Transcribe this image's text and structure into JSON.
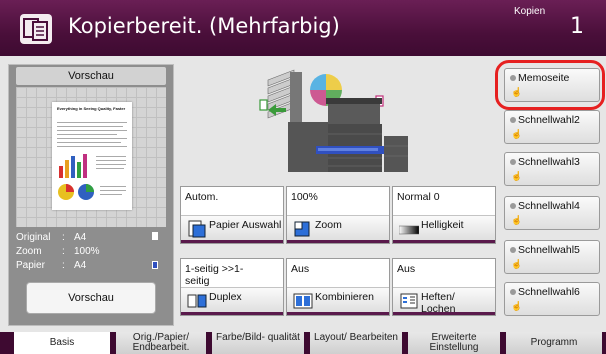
{
  "header": {
    "title": "Kopierbereit. (Mehrfarbig)",
    "copies_label": "Kopien",
    "copies_count": "1",
    "icon": "copy-mode-icon"
  },
  "preview": {
    "heading": "Vorschau",
    "button": "Vorschau",
    "doc_title": "Everything in Seeing Quality, Faster",
    "info": [
      {
        "label": "Original",
        "sep": ":",
        "value": "A4"
      },
      {
        "label": "Zoom",
        "sep": ":",
        "value": "100%"
      },
      {
        "label": "Papier",
        "sep": ":",
        "value": "A4"
      }
    ]
  },
  "functions": [
    {
      "value": "Autom.",
      "label": "Papier Auswahl",
      "icon": "paper-tray-icon"
    },
    {
      "value": "100%",
      "label": "Zoom",
      "icon": "zoom-icon"
    },
    {
      "value": "Normal 0",
      "label": "Helligkeit",
      "icon": "brightness-icon"
    },
    {
      "value": "1-seitig >>1-seitig",
      "label": "Duplex",
      "icon": "duplex-icon"
    },
    {
      "value": "Aus",
      "label": "Kombinieren",
      "icon": "combine-icon"
    },
    {
      "value": "Aus",
      "label": "Heften/ Lochen",
      "icon": "staple-icon"
    }
  ],
  "shortcuts": [
    "Memoseite",
    "Schnellwahl2",
    "Schnellwahl3",
    "Schnellwahl4",
    "Schnellwahl5",
    "Schnellwahl6"
  ],
  "tabs": [
    "Basis",
    "Orig./Papier/ Endbearbeit.",
    "Farbe/Bild- qualität",
    "Layout/ Bearbeiten",
    "Erweiterte Einstellung",
    "Programm"
  ],
  "colors": {
    "header": "#4a0f3a",
    "highlight": "#e62020",
    "accent_green": "#3a9a3a",
    "accent_magenta": "#c0307a"
  }
}
